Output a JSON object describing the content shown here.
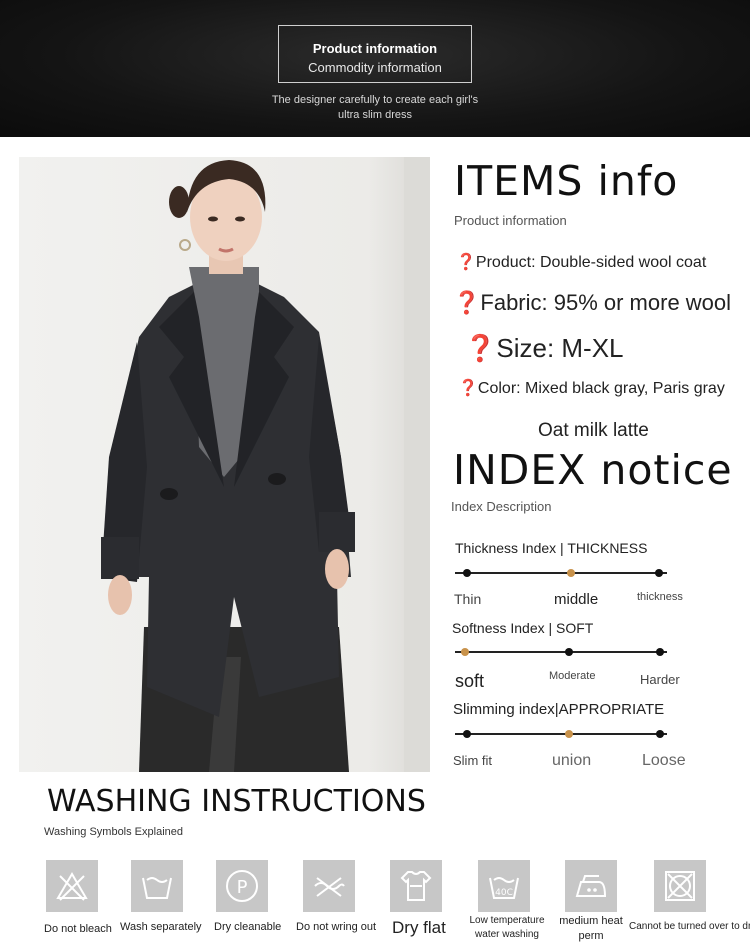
{
  "header": {
    "title": "Product information",
    "subtitle": "Commodity information",
    "tagline_1": "The designer  carefully to create each girl's",
    "tagline_2": "ultra slim dress"
  },
  "items": {
    "title": "ITEMS  info",
    "subtitle": "Product information",
    "product": "❓Product: Double-sided wool coat",
    "fabric": "❓Fabric: 95% or more wool",
    "size": "❓Size: M-XL",
    "color": "❓Color: Mixed black gray, Paris gray",
    "color_2": "Oat milk latte"
  },
  "index": {
    "title": "INDEX  notice",
    "subtitle": "Index Description",
    "thickness": {
      "title": "Thickness Index | THICKNESS",
      "labels": [
        "Thin",
        "middle",
        "thickness"
      ],
      "selected": 1
    },
    "softness": {
      "title": "Softness Index | SOFT",
      "labels": [
        "soft",
        "Moderate",
        "Harder"
      ],
      "selected": 0
    },
    "slimming": {
      "title": "Slimming index|APPROPRIATE",
      "labels": [
        "Slim fit",
        "union",
        "Loose"
      ],
      "selected": 1
    }
  },
  "washing": {
    "title": "WASHING  INSTRUCTIONS",
    "subtitle": "Washing Symbols Explained",
    "items": [
      {
        "label": "Do not bleach",
        "icon": "no-bleach-icon"
      },
      {
        "label": "Wash separately",
        "icon": "wash-basin-icon"
      },
      {
        "label": "Dry cleanable",
        "icon": "dry-clean-p-icon"
      },
      {
        "label": "Do not wring out",
        "icon": "no-wring-icon"
      },
      {
        "label": "Dry flat",
        "icon": "dry-flat-shirt-icon"
      },
      {
        "label": "Low temperature water washing",
        "icon": "wash-40c-icon"
      },
      {
        "label": "medium heat perm",
        "icon": "iron-medium-icon"
      },
      {
        "label": "Cannot be turned over to dry",
        "icon": "no-tumble-dry-icon"
      }
    ]
  },
  "colors": {
    "accent": "#c8924b",
    "header_bg": "#141414",
    "icon_bg": "#c7c7c7"
  }
}
